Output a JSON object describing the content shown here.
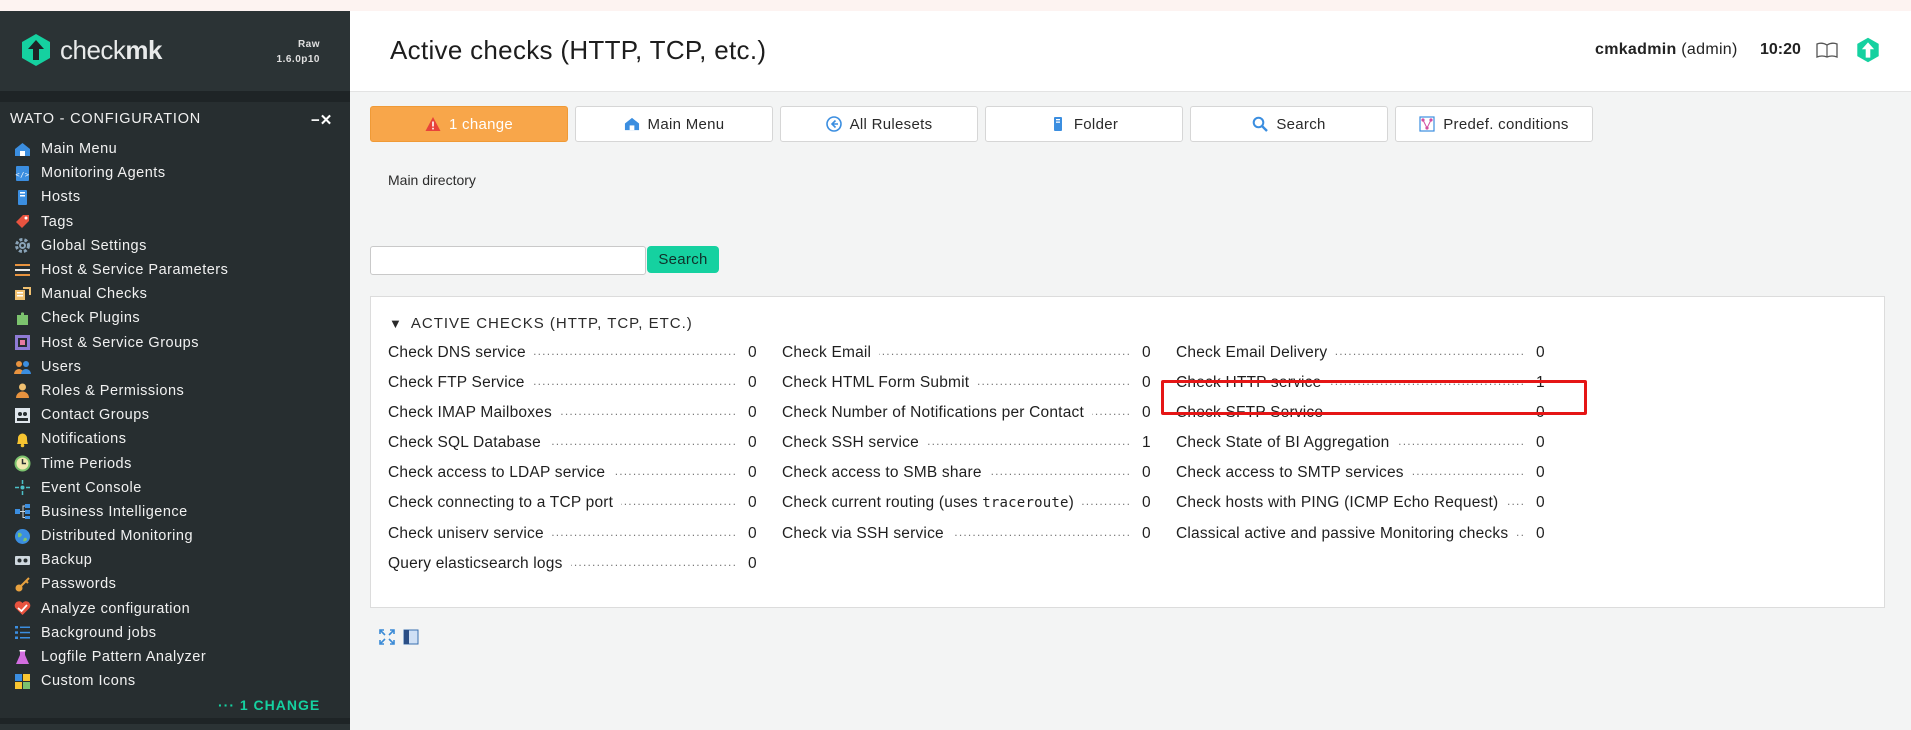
{
  "brand": {
    "name_light": "check",
    "name_bold": "mk",
    "version_line1": "Raw",
    "version_line2": "1.6.0p10"
  },
  "sidebar": {
    "snapin_title": "WATO - CONFIGURATION",
    "snapin_controls": "−✕",
    "items": [
      {
        "label": "Main Menu",
        "icon": "home-icon"
      },
      {
        "label": "Monitoring Agents",
        "icon": "agents-icon"
      },
      {
        "label": "Hosts",
        "icon": "hosts-icon"
      },
      {
        "label": "Tags",
        "icon": "tags-icon"
      },
      {
        "label": "Global Settings",
        "icon": "gear-icon"
      },
      {
        "label": "Host & Service Parameters",
        "icon": "rulesets-icon"
      },
      {
        "label": "Manual Checks",
        "icon": "manual-checks-icon"
      },
      {
        "label": "Check Plugins",
        "icon": "puzzle-icon"
      },
      {
        "label": "Host & Service Groups",
        "icon": "groups-icon"
      },
      {
        "label": "Users",
        "icon": "users-icon"
      },
      {
        "label": "Roles & Permissions",
        "icon": "roles-icon"
      },
      {
        "label": "Contact Groups",
        "icon": "contact-groups-icon"
      },
      {
        "label": "Notifications",
        "icon": "bell-icon"
      },
      {
        "label": "Time Periods",
        "icon": "clock-icon"
      },
      {
        "label": "Event Console",
        "icon": "event-console-icon"
      },
      {
        "label": "Business Intelligence",
        "icon": "bi-icon"
      },
      {
        "label": "Distributed Monitoring",
        "icon": "globe-icon"
      },
      {
        "label": "Backup",
        "icon": "backup-icon"
      },
      {
        "label": "Passwords",
        "icon": "key-icon"
      },
      {
        "label": "Analyze configuration",
        "icon": "analyze-icon"
      },
      {
        "label": "Background jobs",
        "icon": "list-icon"
      },
      {
        "label": "Logfile Pattern Analyzer",
        "icon": "flask-icon"
      },
      {
        "label": "Custom Icons",
        "icon": "icons-icon"
      }
    ],
    "changes_label": "··· 1 CHANGE"
  },
  "header": {
    "title": "Active checks (HTTP, TCP, etc.)",
    "user_name": "cmkadmin",
    "user_role": " (admin)",
    "time": "10:20"
  },
  "toolbar": {
    "buttons": [
      {
        "label": "1 change",
        "icon": "warning-icon"
      },
      {
        "label": "Main Menu",
        "icon": "home-icon"
      },
      {
        "label": "All Rulesets",
        "icon": "back-icon"
      },
      {
        "label": "Folder",
        "icon": "folder-icon"
      },
      {
        "label": "Search",
        "icon": "search-icon"
      },
      {
        "label": "Predef. conditions",
        "icon": "conditions-icon"
      }
    ]
  },
  "breadcrumb": "Main directory",
  "search": {
    "value": "",
    "button_label": "Search"
  },
  "panel": {
    "title": "ACTIVE CHECKS (HTTP, TCP, ETC.)",
    "columns": [
      [
        {
          "label": "Check DNS service",
          "count": "0"
        },
        {
          "label": "Check FTP Service",
          "count": "0"
        },
        {
          "label": "Check IMAP Mailboxes",
          "count": "0"
        },
        {
          "label": "Check SQL Database",
          "count": "0"
        },
        {
          "label": "Check access to LDAP service",
          "count": "0"
        },
        {
          "label": "Check connecting to a TCP port",
          "count": "0"
        },
        {
          "label": "Check uniserv service",
          "count": "0"
        },
        {
          "label": "Query elasticsearch logs",
          "count": "0"
        }
      ],
      [
        {
          "label": "Check Email",
          "count": "0"
        },
        {
          "label": "Check HTML Form Submit",
          "count": "0"
        },
        {
          "label": "Check Number of Notifications per Contact",
          "count": "0"
        },
        {
          "label": "Check SSH service",
          "count": "1"
        },
        {
          "label": "Check access to SMB share",
          "count": "0"
        },
        {
          "label": "Check current routing (uses ",
          "label_mono": "traceroute",
          "label_suffix": ")",
          "count": "0"
        },
        {
          "label": "Check via SSH service",
          "count": "0"
        }
      ],
      [
        {
          "label": "Check Email Delivery",
          "count": "0"
        },
        {
          "label": "Check HTTP service",
          "count": "1"
        },
        {
          "label": "Check SFTP Service",
          "count": "0"
        },
        {
          "label": "Check State of BI Aggregation",
          "count": "0"
        },
        {
          "label": "Check access to SMTP services",
          "count": "0"
        },
        {
          "label": "Check hosts with PING (ICMP Echo Request)",
          "count": "0"
        },
        {
          "label": "Classical active and passive Monitoring checks",
          "count": "0"
        }
      ]
    ]
  },
  "colors": {
    "accent": "#15d1a0",
    "warning": "#f8a64a",
    "highlight": "#e51515",
    "sidebar_bg": "#272e30"
  }
}
